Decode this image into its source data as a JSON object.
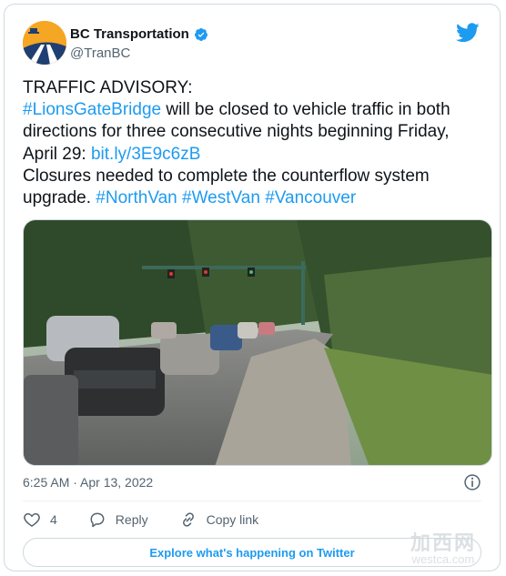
{
  "account": {
    "display_name": "BC Transportation",
    "handle": "@TranBC",
    "verified": true
  },
  "tweet": {
    "line1": "TRAFFIC ADVISORY:",
    "hashtag_bridge": "#LionsGateBridge",
    "text_closed": " will be closed to vehicle traffic in both directions for three consecutive nights beginning Friday, April 29: ",
    "link": "bit.ly/3E9c6zB",
    "text_closures": "Closures needed to complete the counterflow system upgrade. ",
    "hashtag_northvan": "#NorthVan",
    "hashtag_westvan": "#WestVan",
    "hashtag_vancouver": "#Vancouver"
  },
  "meta": {
    "timestamp": "6:25 AM · Apr 13, 2022"
  },
  "actions": {
    "like_count": "4",
    "reply_label": "Reply",
    "copy_link_label": "Copy link"
  },
  "explore_label": "Explore what's happening on Twitter",
  "watermark": {
    "cn": "加西网",
    "en": "westca.com"
  },
  "colors": {
    "accent": "#1d9bf0",
    "text": "#0f1419",
    "muted": "#536471",
    "border": "#cfd9de"
  }
}
